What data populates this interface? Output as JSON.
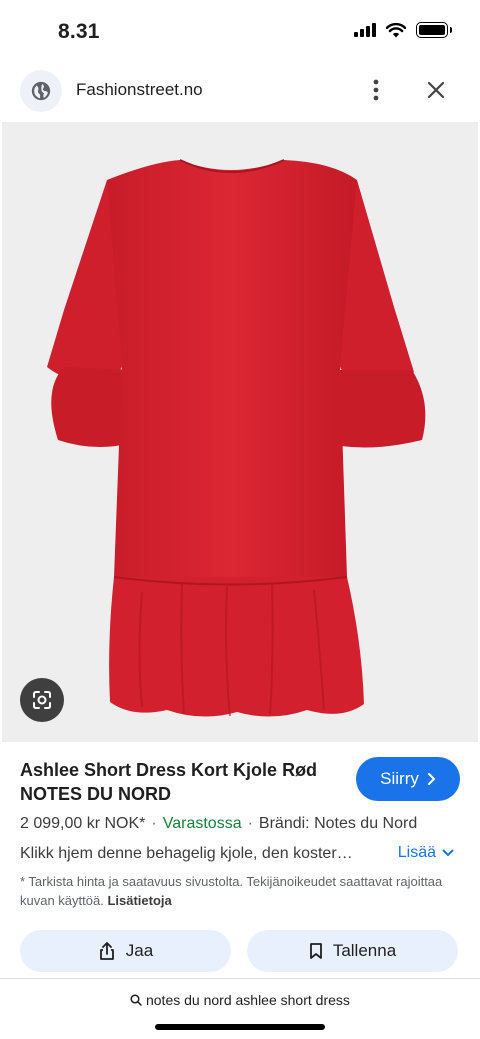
{
  "status": {
    "time": "8.31"
  },
  "browser": {
    "site": "Fashionstreet.no"
  },
  "product": {
    "title_line1": "Ashlee Short Dress Kort Kjole Rød",
    "title_line2": "NOTES DU NORD",
    "visit_label": "Siirry",
    "price": "2 099,00 kr NOK*",
    "stock": "Varastossa",
    "brand": "Brändi: Notes du Nord",
    "description": "Klikk hjem denne behagelig kjole, den koster…",
    "more_label": "Lisää",
    "disclaimer": "* Tarkista hinta ja saatavuus sivustolta. Tekijänoikeudet saattavat rajoittaa kuvan käyttöä.",
    "disclaimer_link": "Lisätietoja",
    "dress_color": "#d4212e"
  },
  "actions": {
    "share_label": "Jaa",
    "save_label": "Tallenna"
  },
  "search": {
    "query": "notes du nord ashlee short dress"
  },
  "colors": {
    "accent": "#1a73e8",
    "stock_green": "#188038",
    "pill_bg": "#e8f0fe"
  }
}
